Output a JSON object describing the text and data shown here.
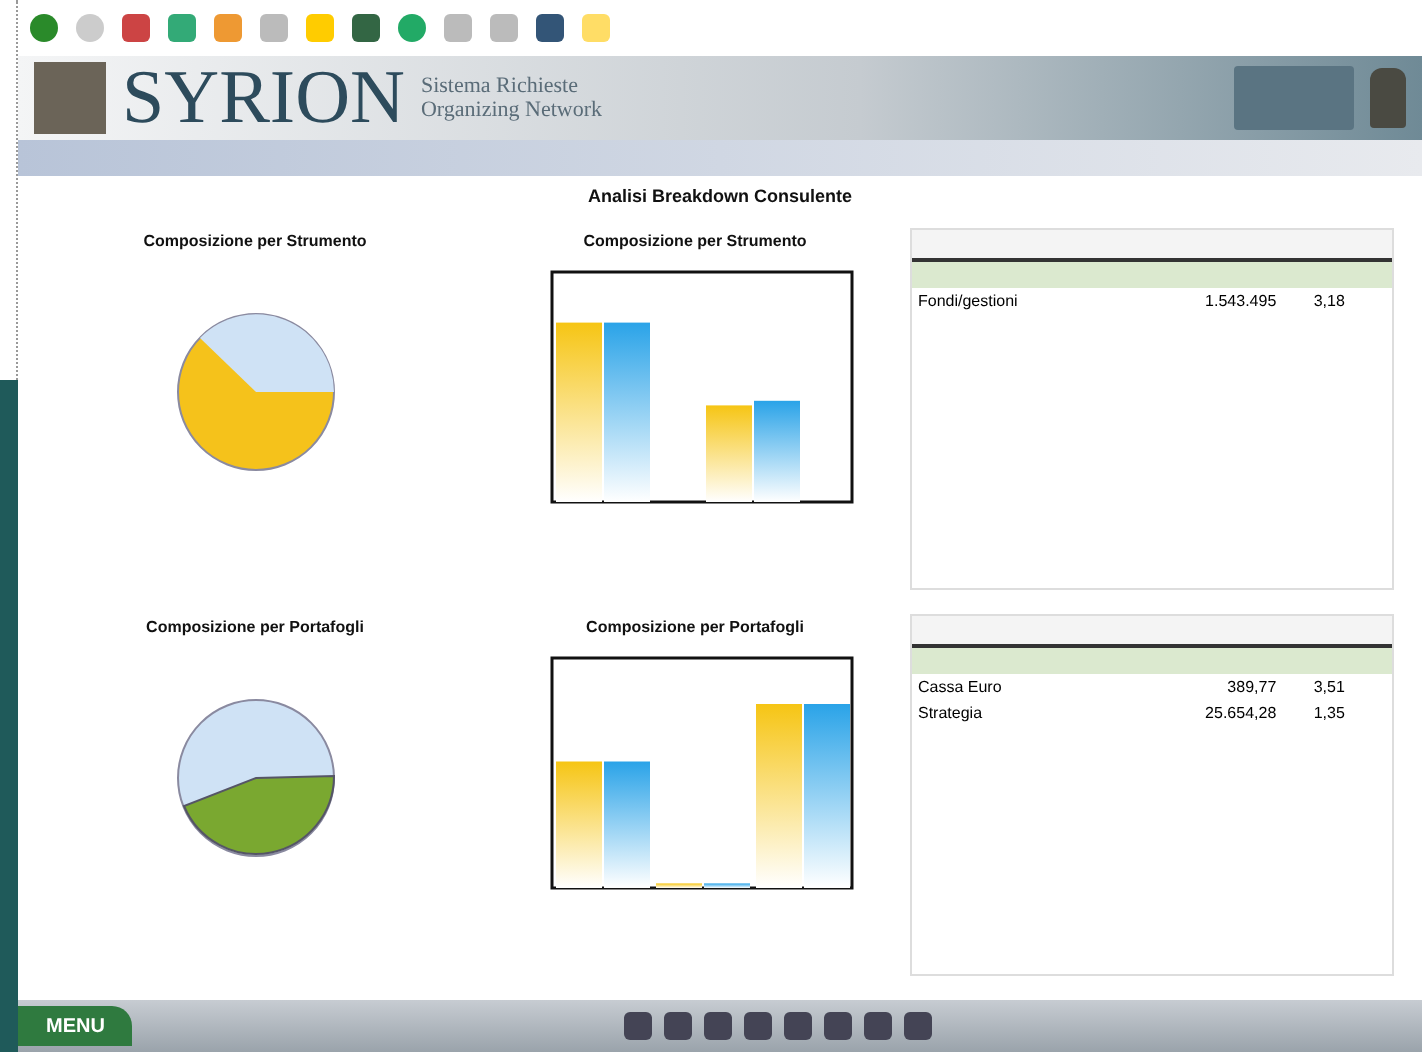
{
  "brand": {
    "name": "SYRION",
    "tagline": [
      "Sistema Richieste",
      "Organizing Network"
    ]
  },
  "report_title": "Analisi Breakdown Consulente",
  "panels": [
    {
      "kind": "strumento",
      "pie_title": "Composizione per Strumento",
      "bar_title": "Composizione per Strumento",
      "table": {
        "rows": [
          {
            "cells": [],
            "selected": true
          },
          {
            "cells": [
              "Fondi/gestioni",
              "1.543.495",
              "3,18"
            ],
            "selected": false
          }
        ]
      }
    },
    {
      "kind": "portafogli",
      "pie_title": "Composizione per Portafogli",
      "bar_title": "Composizione per Portafogli",
      "table": {
        "rows": [
          {
            "cells": [],
            "selected": true
          },
          {
            "cells": [
              "Cassa Euro",
              "389,77",
              "3,51"
            ],
            "selected": false
          },
          {
            "cells": [
              "Strategia",
              "25.654,28",
              "1,35"
            ],
            "selected": false
          }
        ]
      }
    }
  ],
  "menu_button": "MENU"
}
